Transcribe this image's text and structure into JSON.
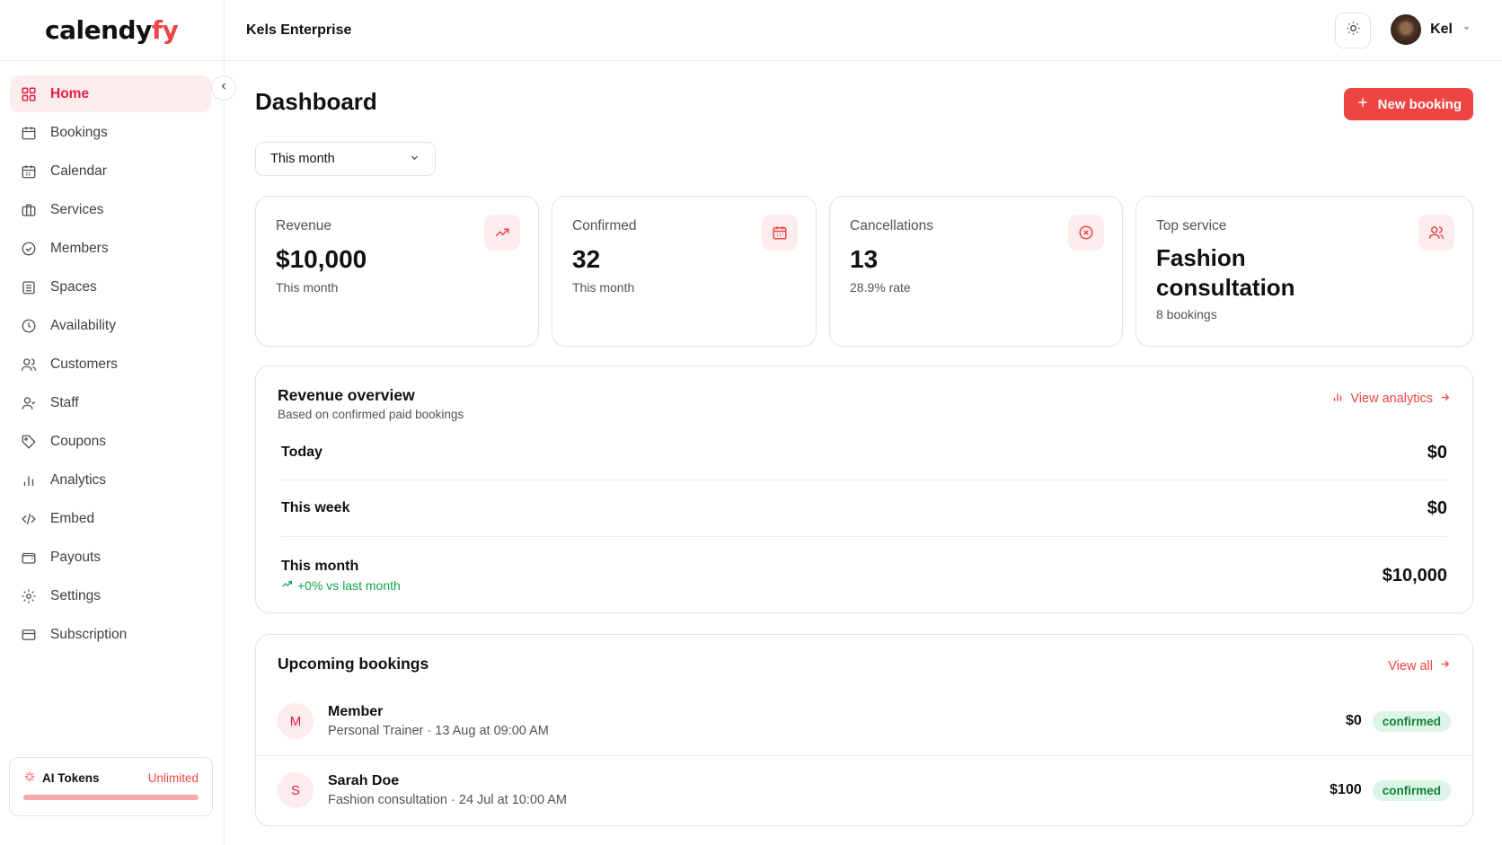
{
  "brand": {
    "logo_main": "calendy",
    "logo_accent": "fy"
  },
  "header": {
    "org_name": "Kels Enterprise",
    "user_name": "Kel"
  },
  "sidebar": {
    "items": [
      {
        "label": "Home",
        "icon": "grid-icon"
      },
      {
        "label": "Bookings",
        "icon": "calendar-icon"
      },
      {
        "label": "Calendar",
        "icon": "calendar-icon"
      },
      {
        "label": "Services",
        "icon": "briefcase-icon"
      },
      {
        "label": "Members",
        "icon": "badge-check-icon"
      },
      {
        "label": "Spaces",
        "icon": "building-icon"
      },
      {
        "label": "Availability",
        "icon": "clock-icon"
      },
      {
        "label": "Customers",
        "icon": "users-icon"
      },
      {
        "label": "Staff",
        "icon": "user-icon"
      },
      {
        "label": "Coupons",
        "icon": "tag-icon"
      },
      {
        "label": "Analytics",
        "icon": "bar-chart-icon"
      },
      {
        "label": "Embed",
        "icon": "code-icon"
      },
      {
        "label": "Payouts",
        "icon": "wallet-icon"
      },
      {
        "label": "Settings",
        "icon": "gear-icon"
      },
      {
        "label": "Subscription",
        "icon": "credit-card-icon"
      }
    ],
    "tokens": {
      "label": "AI Tokens",
      "value": "Unlimited"
    }
  },
  "main": {
    "title": "Dashboard",
    "new_booking_label": "New booking",
    "period": "This month",
    "stats": [
      {
        "label": "Revenue",
        "value": "$10,000",
        "sub": "This month",
        "icon": "trending-up-icon"
      },
      {
        "label": "Confirmed",
        "value": "32",
        "sub": "This month",
        "icon": "calendar-icon"
      },
      {
        "label": "Cancellations",
        "value": "13",
        "sub": "28.9% rate",
        "icon": "x-circle-icon"
      },
      {
        "label": "Top service",
        "value": "Fashion consultation",
        "sub": "8 bookings",
        "icon": "users-icon"
      }
    ],
    "overview": {
      "title": "Revenue overview",
      "subtitle": "Based on confirmed paid bookings",
      "link": "View analytics",
      "rows": [
        {
          "label": "Today",
          "value": "$0"
        },
        {
          "label": "This week",
          "value": "$0"
        },
        {
          "label": "This month",
          "value": "$10,000",
          "trend": "+0% vs last month"
        }
      ]
    },
    "upcoming": {
      "title": "Upcoming bookings",
      "link": "View all",
      "bookings": [
        {
          "initial": "M",
          "name": "Member",
          "meta": "Personal Trainer · 13 Aug at 09:00 AM",
          "amount": "$0",
          "status": "confirmed"
        },
        {
          "initial": "S",
          "name": "Sarah Doe",
          "meta": "Fashion consultation · 24 Jul at 10:00 AM",
          "amount": "$100",
          "status": "confirmed"
        }
      ]
    }
  },
  "colors": {
    "accent": "#ef4444",
    "accent_bg": "#fdecec",
    "success": "#16a34a",
    "success_bg": "#dcf5e6"
  }
}
